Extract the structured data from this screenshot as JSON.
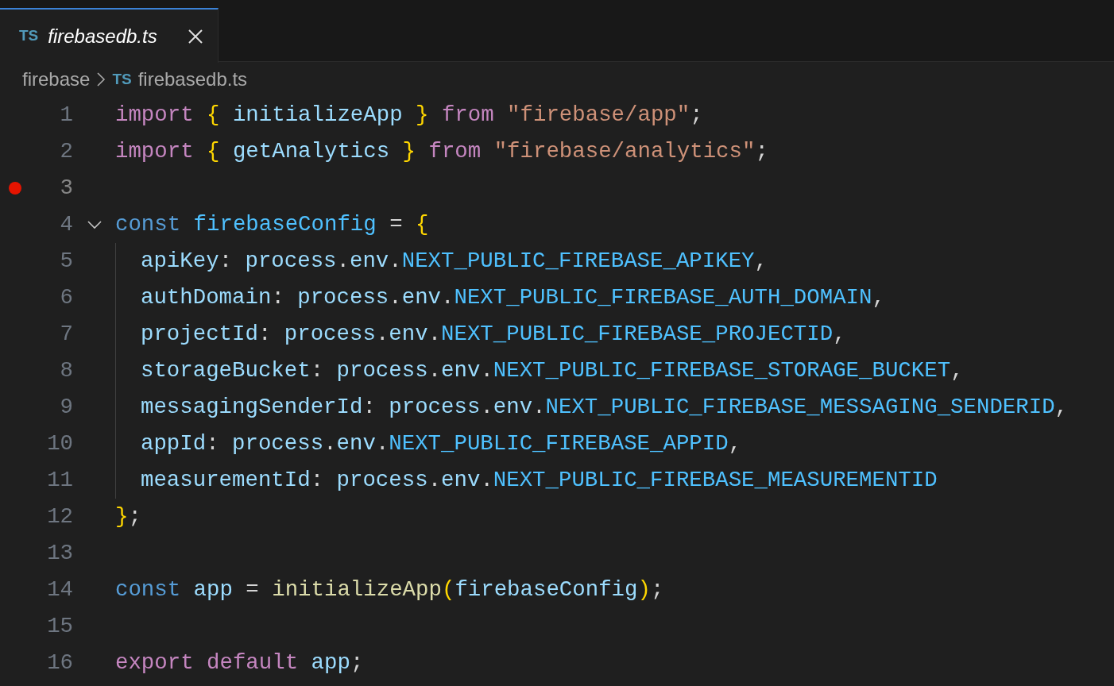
{
  "tabs": [
    {
      "file_badge": "TS",
      "label": "firebasedb.ts",
      "selected": true,
      "preview": true
    }
  ],
  "breadcrumb": [
    {
      "label": "firebase"
    },
    {
      "file_badge": "TS",
      "label": "firebasedb.ts"
    }
  ],
  "lines": [
    {
      "number": "1",
      "breakpoint": false,
      "tokens": [
        {
          "kind": "keyword",
          "text": "import"
        },
        {
          "kind": "brace",
          "text": " {"
        },
        {
          "kind": "variable",
          "text": " initializeApp"
        },
        {
          "kind": "brace",
          "text": " }"
        },
        {
          "kind": "keyword",
          "text": " from"
        },
        {
          "kind": "string",
          "text": " \"firebase/app\""
        },
        {
          "kind": "punct",
          "text": ";"
        }
      ]
    },
    {
      "number": "2",
      "breakpoint": false,
      "tokens": [
        {
          "kind": "keyword",
          "text": "import"
        },
        {
          "kind": "brace",
          "text": " {"
        },
        {
          "kind": "variable",
          "text": " getAnalytics"
        },
        {
          "kind": "brace",
          "text": " }"
        },
        {
          "kind": "keyword",
          "text": " from"
        },
        {
          "kind": "string",
          "text": " \"firebase/analytics\""
        },
        {
          "kind": "punct",
          "text": ";"
        }
      ]
    },
    {
      "number": "3",
      "breakpoint": true
    },
    {
      "number": "4",
      "breakpoint": false,
      "expanded": true,
      "tokens": [
        {
          "kind": "storage",
          "text": "const"
        },
        {
          "kind": "constant",
          "text": " firebaseConfig"
        },
        {
          "kind": "punct",
          "text": " ="
        },
        {
          "kind": "brace",
          "text": " {"
        }
      ],
      "children": [
        {
          "number": "5",
          "breakpoint": false,
          "tokens": [
            {
              "kind": "variable",
              "text": "apiKey"
            },
            {
              "kind": "punct",
              "text": ":"
            },
            {
              "kind": "variable",
              "text": " process"
            },
            {
              "kind": "punct",
              "text": "."
            },
            {
              "kind": "variable",
              "text": "env"
            },
            {
              "kind": "punct",
              "text": "."
            },
            {
              "kind": "constant",
              "text": "NEXT_PUBLIC_FIREBASE_APIKEY"
            },
            {
              "kind": "punct",
              "text": ","
            }
          ]
        },
        {
          "number": "6",
          "breakpoint": false,
          "tokens": [
            {
              "kind": "variable",
              "text": "authDomain"
            },
            {
              "kind": "punct",
              "text": ":"
            },
            {
              "kind": "variable",
              "text": " process"
            },
            {
              "kind": "punct",
              "text": "."
            },
            {
              "kind": "variable",
              "text": "env"
            },
            {
              "kind": "punct",
              "text": "."
            },
            {
              "kind": "constant",
              "text": "NEXT_PUBLIC_FIREBASE_AUTH_DOMAIN"
            },
            {
              "kind": "punct",
              "text": ","
            }
          ]
        },
        {
          "number": "7",
          "breakpoint": false,
          "tokens": [
            {
              "kind": "variable",
              "text": "projectId"
            },
            {
              "kind": "punct",
              "text": ":"
            },
            {
              "kind": "variable",
              "text": " process"
            },
            {
              "kind": "punct",
              "text": "."
            },
            {
              "kind": "variable",
              "text": "env"
            },
            {
              "kind": "punct",
              "text": "."
            },
            {
              "kind": "constant",
              "text": "NEXT_PUBLIC_FIREBASE_PROJECTID"
            },
            {
              "kind": "punct",
              "text": ","
            }
          ]
        },
        {
          "number": "8",
          "breakpoint": false,
          "tokens": [
            {
              "kind": "variable",
              "text": "storageBucket"
            },
            {
              "kind": "punct",
              "text": ":"
            },
            {
              "kind": "variable",
              "text": " process"
            },
            {
              "kind": "punct",
              "text": "."
            },
            {
              "kind": "variable",
              "text": "env"
            },
            {
              "kind": "punct",
              "text": "."
            },
            {
              "kind": "constant",
              "text": "NEXT_PUBLIC_FIREBASE_STORAGE_BUCKET"
            },
            {
              "kind": "punct",
              "text": ","
            }
          ]
        },
        {
          "number": "9",
          "breakpoint": false,
          "tokens": [
            {
              "kind": "variable",
              "text": "messagingSenderId"
            },
            {
              "kind": "punct",
              "text": ":"
            },
            {
              "kind": "variable",
              "text": " process"
            },
            {
              "kind": "punct",
              "text": "."
            },
            {
              "kind": "variable",
              "text": "env"
            },
            {
              "kind": "punct",
              "text": "."
            },
            {
              "kind": "constant",
              "text": "NEXT_PUBLIC_FIREBASE_MESSAGING_SENDERID"
            },
            {
              "kind": "punct",
              "text": ","
            }
          ]
        },
        {
          "number": "10",
          "breakpoint": false,
          "tokens": [
            {
              "kind": "variable",
              "text": "appId"
            },
            {
              "kind": "punct",
              "text": ":"
            },
            {
              "kind": "variable",
              "text": " process"
            },
            {
              "kind": "punct",
              "text": "."
            },
            {
              "kind": "variable",
              "text": "env"
            },
            {
              "kind": "punct",
              "text": "."
            },
            {
              "kind": "constant",
              "text": "NEXT_PUBLIC_FIREBASE_APPID"
            },
            {
              "kind": "punct",
              "text": ","
            }
          ]
        },
        {
          "number": "11",
          "breakpoint": false,
          "tokens": [
            {
              "kind": "variable",
              "text": "measurementId"
            },
            {
              "kind": "punct",
              "text": ":"
            },
            {
              "kind": "variable",
              "text": " process"
            },
            {
              "kind": "punct",
              "text": "."
            },
            {
              "kind": "variable",
              "text": "env"
            },
            {
              "kind": "punct",
              "text": "."
            },
            {
              "kind": "constant",
              "text": "NEXT_PUBLIC_FIREBASE_MEASUREMENTID"
            }
          ]
        }
      ]
    },
    {
      "number": "12",
      "breakpoint": false,
      "tokens": [
        {
          "kind": "brace",
          "text": "}"
        },
        {
          "kind": "punct",
          "text": ";"
        }
      ]
    },
    {
      "number": "13",
      "breakpoint": false
    },
    {
      "number": "14",
      "breakpoint": false,
      "tokens": [
        {
          "kind": "storage",
          "text": "const"
        },
        {
          "kind": "variable",
          "text": " app"
        },
        {
          "kind": "punct",
          "text": " ="
        },
        {
          "kind": "function",
          "text": " initializeApp"
        },
        {
          "kind": "brace",
          "text": "("
        },
        {
          "kind": "variable",
          "text": "firebaseConfig"
        },
        {
          "kind": "brace",
          "text": ")"
        },
        {
          "kind": "punct",
          "text": ";"
        }
      ]
    },
    {
      "number": "15",
      "breakpoint": false
    },
    {
      "number": "16",
      "breakpoint": false,
      "tokens": [
        {
          "kind": "keyword",
          "text": "export"
        },
        {
          "kind": "keyword",
          "text": " default"
        },
        {
          "kind": "variable",
          "text": " app"
        },
        {
          "kind": "punct",
          "text": ";"
        }
      ]
    }
  ]
}
